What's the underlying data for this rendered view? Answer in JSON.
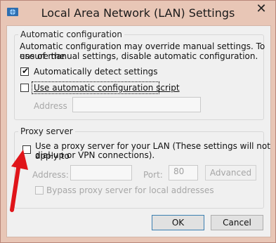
{
  "window": {
    "title": "Local Area Network (LAN) Settings",
    "close_glyph": "✕"
  },
  "automatic_configuration": {
    "legend": "Automatic configuration",
    "description_line1": "Automatic configuration may override manual settings.  To ensure the",
    "description_line2": "use of manual settings, disable automatic configuration.",
    "auto_detect": {
      "label": "Automatically detect settings",
      "checked": true
    },
    "use_script": {
      "label": "Use automatic configuration script",
      "checked": false
    },
    "address_label": "Address",
    "address_value": ""
  },
  "proxy_server": {
    "legend": "Proxy server",
    "use_proxy": {
      "label_line1": "Use a proxy server for your LAN (These settings will not apply to",
      "label_line2": "dial-up or VPN connections).",
      "checked": false
    },
    "address_label": "Address:",
    "address_value": "",
    "port_label": "Port:",
    "port_value": "80",
    "advanced_label": "Advanced",
    "bypass": {
      "label": "Bypass proxy server for local addresses",
      "checked": false
    }
  },
  "buttons": {
    "ok": "OK",
    "cancel": "Cancel"
  },
  "annotation": {
    "arrow_color": "#e0151a"
  }
}
